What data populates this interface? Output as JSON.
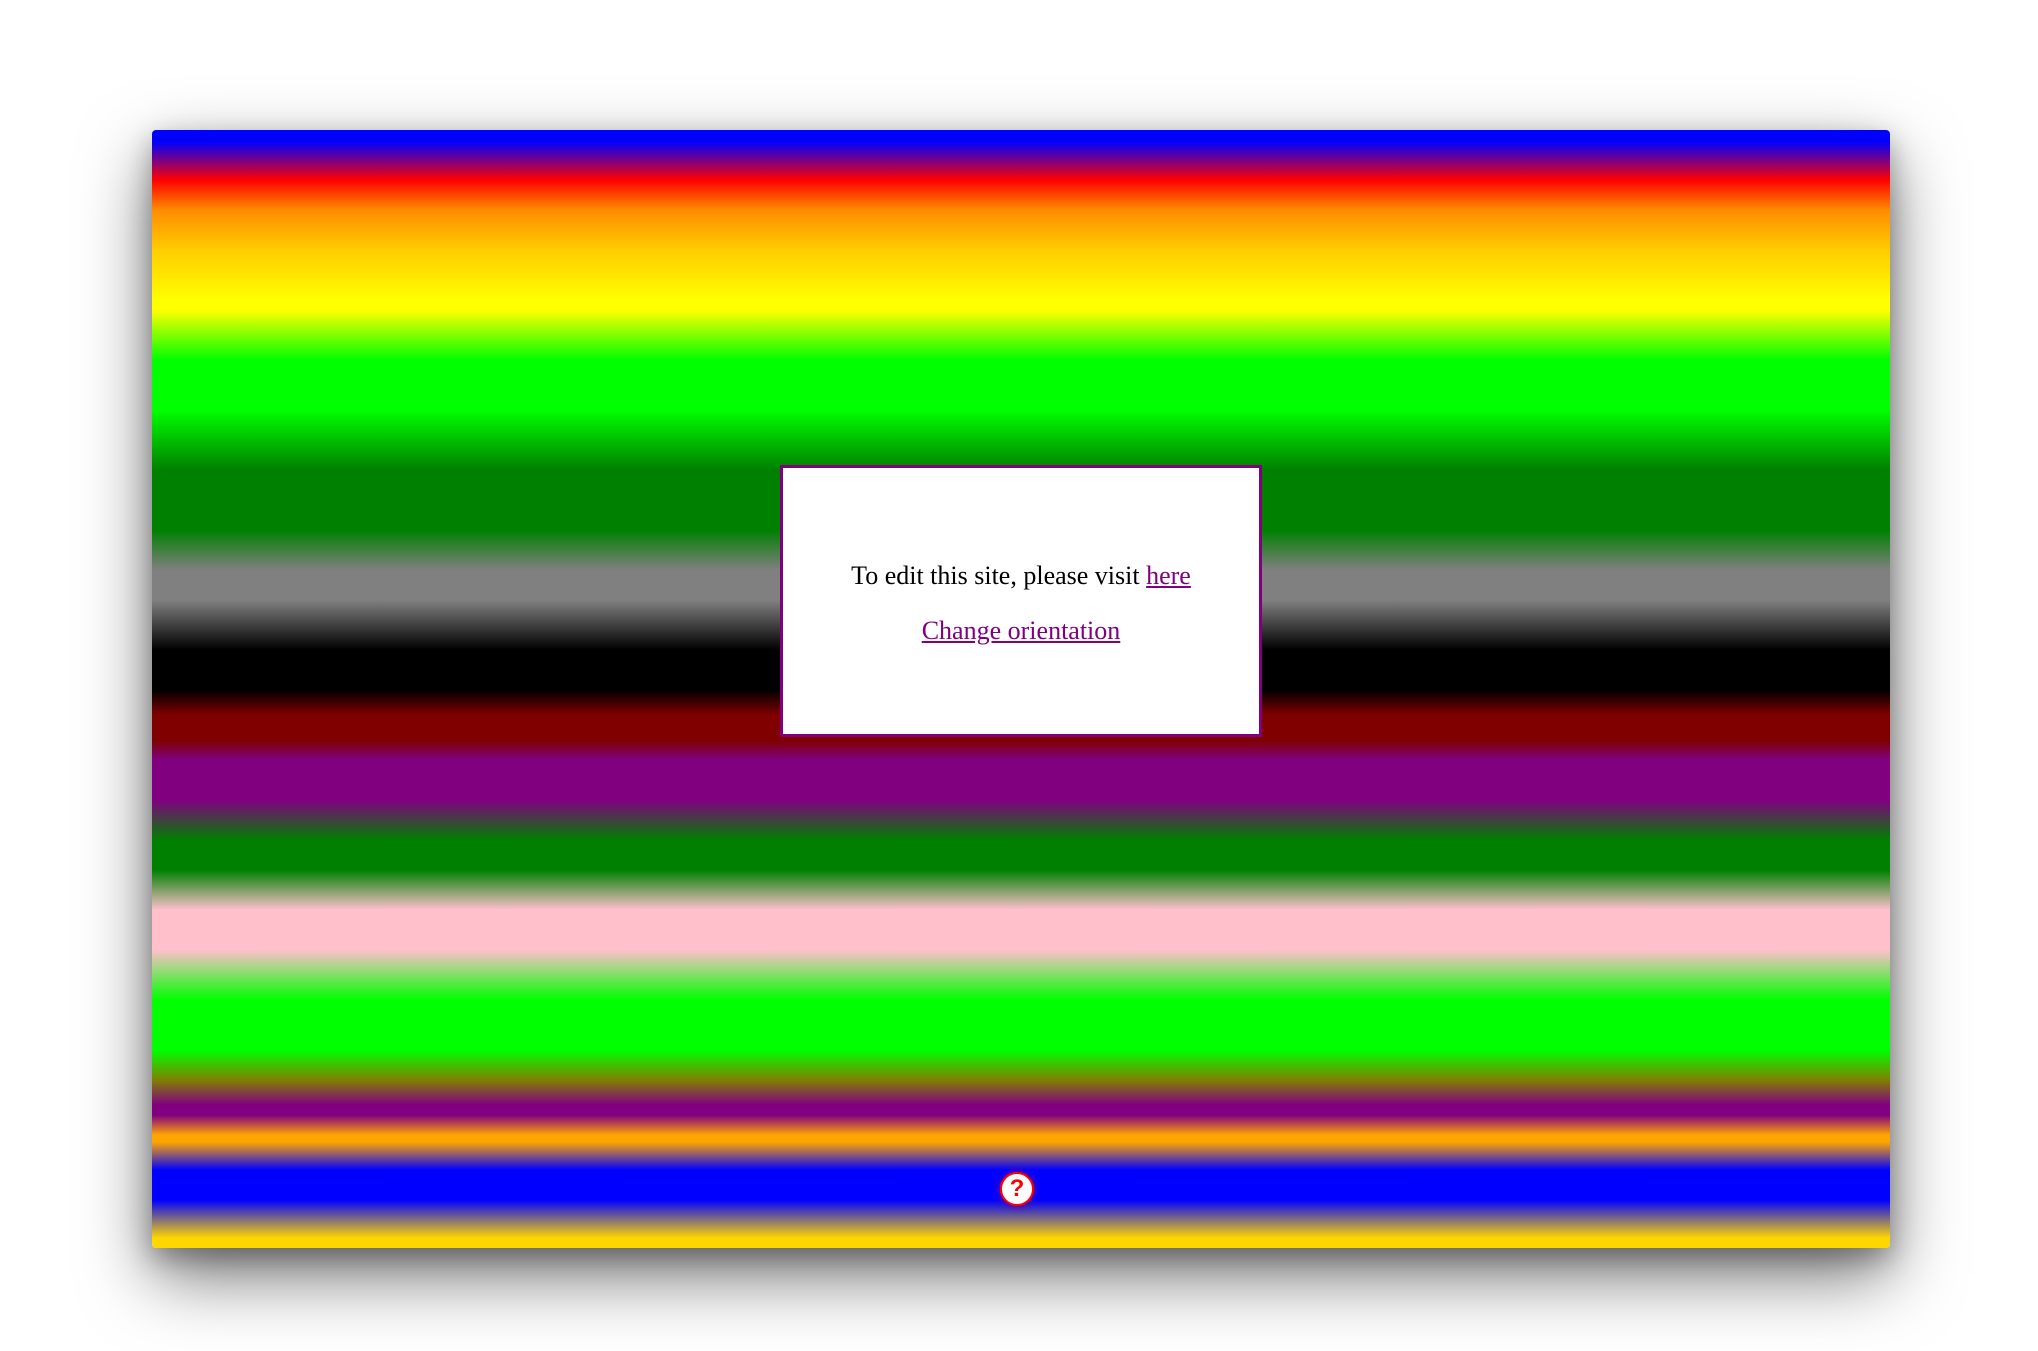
{
  "dialog": {
    "message": "To edit this site, please visit ",
    "link_label": "here",
    "orientation_label": "Change orientation"
  },
  "help": {
    "glyph": "?",
    "icon": "question-mark-icon"
  },
  "colors": {
    "link": "#800080",
    "dialog_border": "#800080",
    "help_accent": "#ff0000",
    "background_stripes": [
      "blue",
      "red",
      "orange",
      "yellow",
      "lime",
      "green",
      "gray",
      "black",
      "maroon",
      "purple",
      "green",
      "pink",
      "lime",
      "olive",
      "purple",
      "orange",
      "blue",
      "gold"
    ]
  }
}
